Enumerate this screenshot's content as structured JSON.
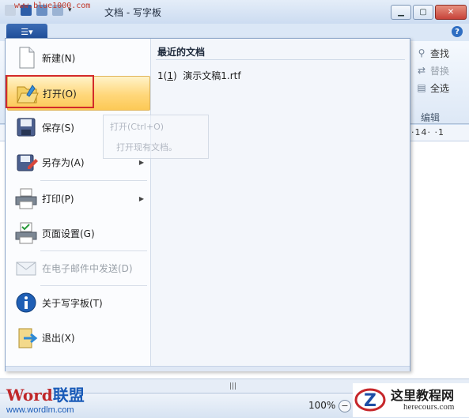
{
  "watermark_top": "www.blue1000.com",
  "window": {
    "title": "文档 - 写字板",
    "minimize": "▁",
    "maximize": "▢",
    "close": "✕",
    "help": "?"
  },
  "app_button": "☰▾",
  "ribbon": {
    "edit_group": {
      "find": "查找",
      "replace": "替换",
      "select_all": "全选",
      "label": "编辑"
    }
  },
  "ruler": {
    "marks": "·14·  ·1"
  },
  "menu": {
    "items": [
      {
        "label": "新建(N)",
        "icon": "new-document-icon"
      },
      {
        "label": "打开(O)",
        "icon": "open-folder-icon"
      },
      {
        "label": "保存(S)",
        "icon": "save-icon"
      },
      {
        "label": "另存为(A)",
        "icon": "save-as-icon",
        "submenu": true
      },
      {
        "label": "打印(P)",
        "icon": "printer-icon",
        "submenu": true
      },
      {
        "label": "页面设置(G)",
        "icon": "page-setup-icon"
      },
      {
        "label": "在电子邮件中发送(D)",
        "icon": "email-icon",
        "disabled": true
      },
      {
        "label": "关于写字板(T)",
        "icon": "info-icon"
      },
      {
        "label": "退出(X)",
        "icon": "exit-icon"
      }
    ],
    "recent_title": "最近的文档",
    "recent": [
      {
        "index": "1",
        "index_key": "1",
        "name": "演示文稿1.rtf"
      }
    ],
    "tooltip": {
      "line1": "打开(Ctrl+O)",
      "line2": "打开现有文档。"
    }
  },
  "status": {
    "zoom": "100%",
    "zoom_minus": "−",
    "scroll_grip": "|||"
  },
  "watermarks": {
    "word_brand_a": "Word",
    "word_brand_b": "联盟",
    "word_url": "www.wordlm.com",
    "site_cn": "这里教程网",
    "site_en": "herecours.com"
  },
  "colors": {
    "highlight": "#ffd77a",
    "red_box": "#d32a2a",
    "accent": "#1d4c97"
  }
}
